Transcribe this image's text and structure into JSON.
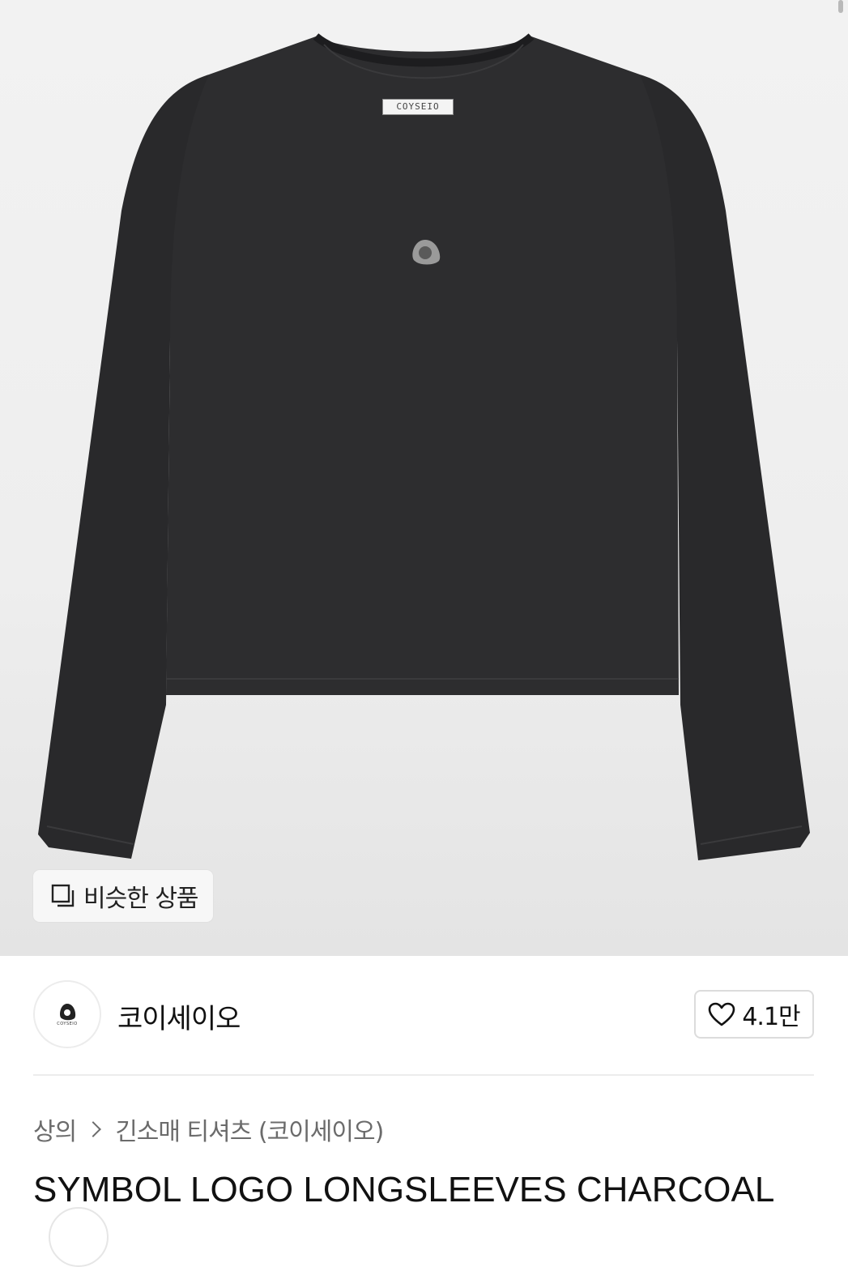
{
  "product_image": {
    "collar_label": "COYSEIO",
    "similar_products_label": "비슷한 상품"
  },
  "brand": {
    "name": "코이세이오",
    "logo_small_text": "COYSEIO",
    "like_count": "4.1만"
  },
  "breadcrumb": {
    "category": "상의",
    "subcategory": "긴소매 티셔츠 (코이세이오)"
  },
  "product": {
    "title": "SYMBOL LOGO LONGSLEEVES CHARCOAL"
  },
  "colors": {
    "garment": "#2b2b2d",
    "background": "#eeeeee",
    "text_primary": "#111111",
    "text_secondary": "#6b6b6b"
  }
}
